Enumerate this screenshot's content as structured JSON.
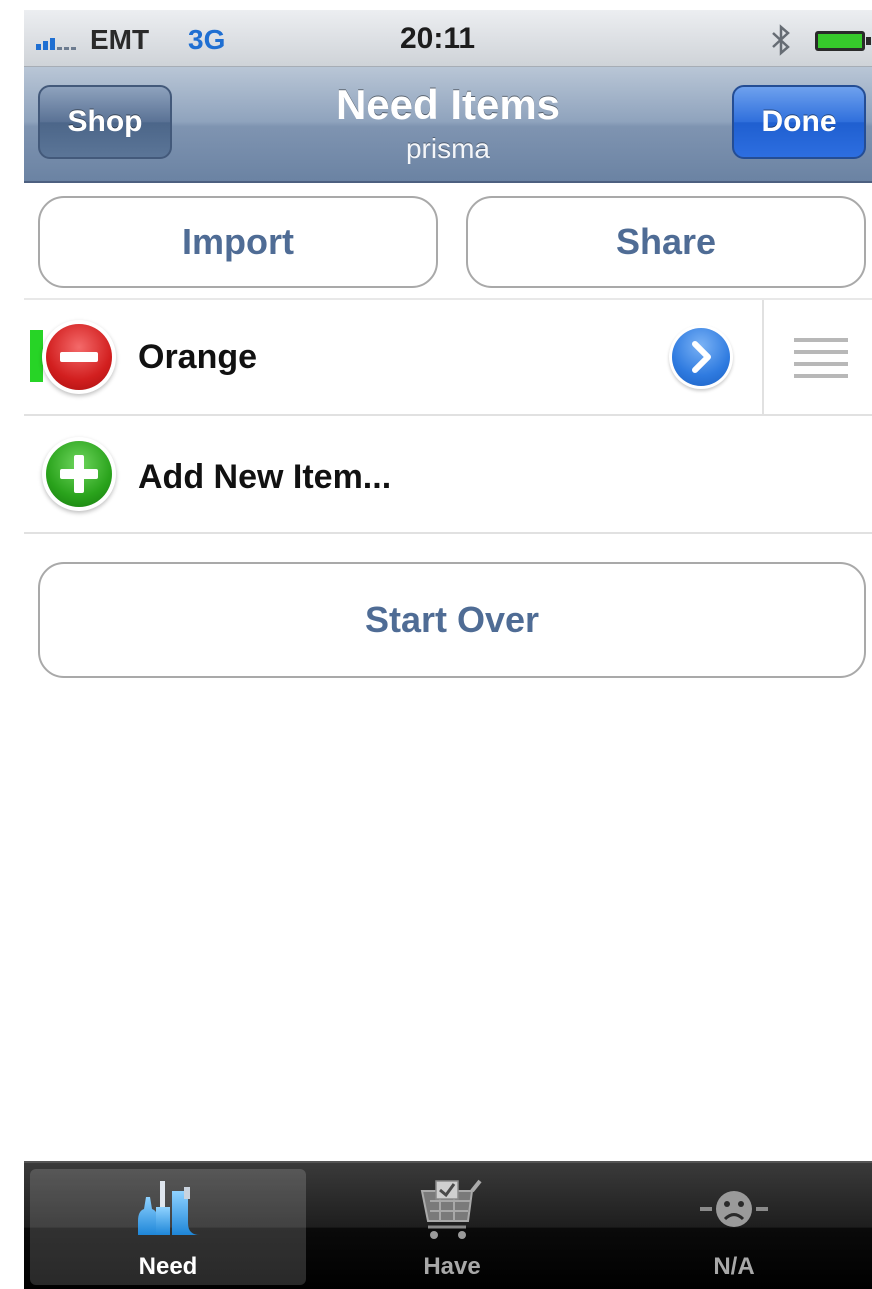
{
  "status_bar": {
    "carrier": "EMT",
    "network": "3G",
    "time": "20:11"
  },
  "nav_bar": {
    "title": "Need Items",
    "subtitle": "prisma",
    "left_button": "Shop",
    "right_button": "Done"
  },
  "actions": {
    "import_label": "Import",
    "share_label": "Share",
    "start_over_label": "Start Over"
  },
  "list": {
    "items": [
      {
        "label": "Orange"
      }
    ],
    "add_item_label": "Add New Item..."
  },
  "tab_bar": {
    "tabs": [
      {
        "label": "Need",
        "icon": "bottles-icon",
        "selected": true
      },
      {
        "label": "Have",
        "icon": "shopping-cart-icon",
        "selected": false
      },
      {
        "label": "N/A",
        "icon": "sad-face-icon",
        "selected": false
      }
    ]
  },
  "colors": {
    "nav_bar": "#7f94b1",
    "done_button": "#2f6fdc",
    "button_text": "#4f6c95",
    "status_marker": "#27d426",
    "delete": "#d21f1f",
    "add": "#2aa31c"
  }
}
